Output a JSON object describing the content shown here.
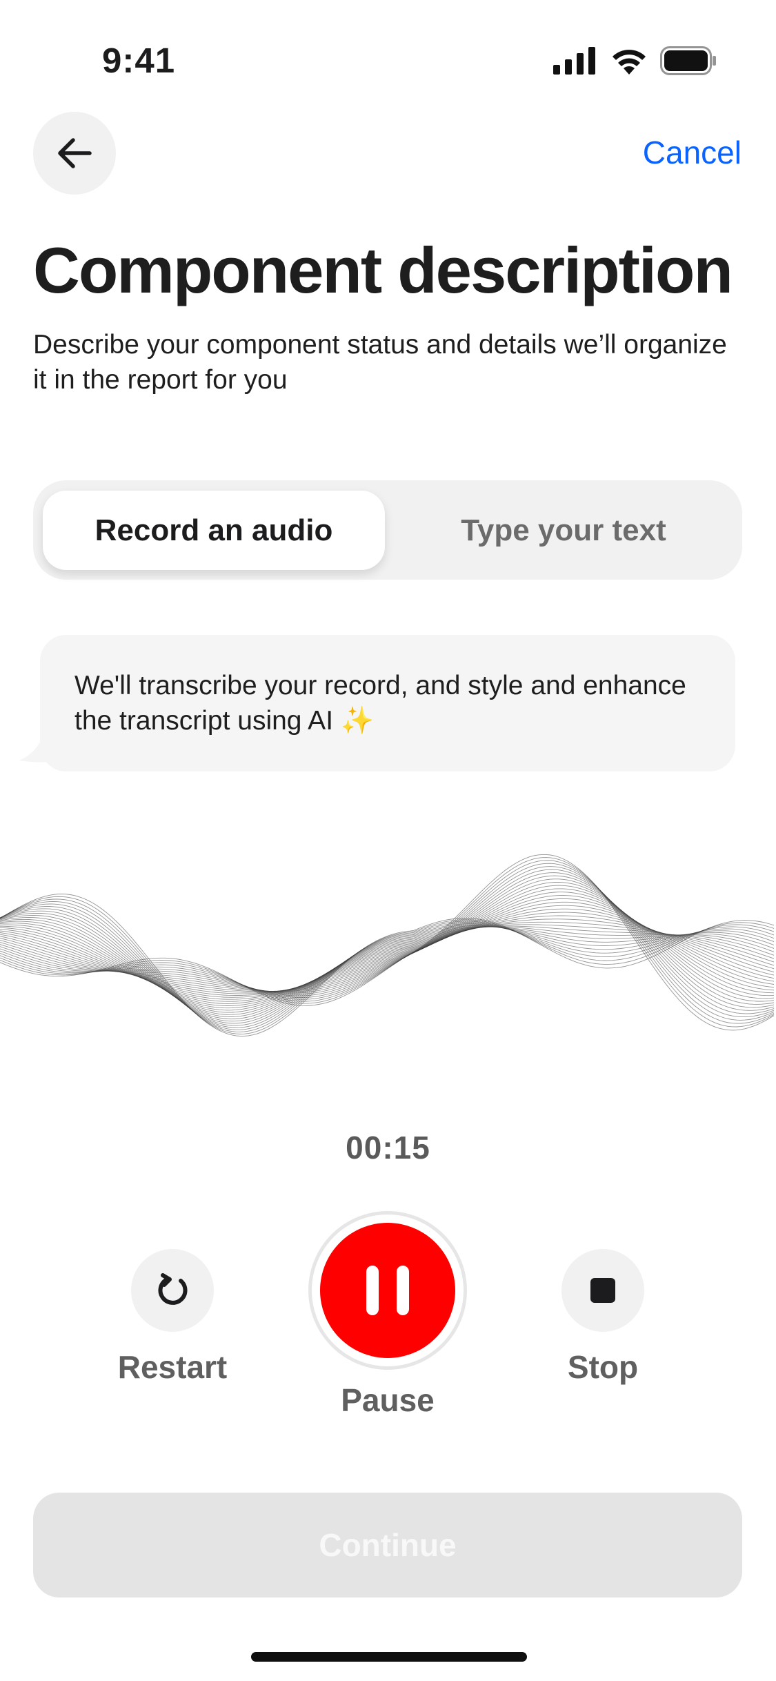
{
  "status_bar": {
    "time": "9:41"
  },
  "nav": {
    "cancel_label": "Cancel"
  },
  "header": {
    "title": "Component description",
    "subtitle": "Describe your component status and details we’ll organize it in the report for you"
  },
  "tabs": [
    {
      "label": "Record an audio",
      "selected": true
    },
    {
      "label": "Type your text",
      "selected": false
    }
  ],
  "info": {
    "text": "We'll transcribe your record, and style and enhance the transcript using AI ✨"
  },
  "recording": {
    "timer": "00:15",
    "restart_label": "Restart",
    "pause_label": "Pause",
    "stop_label": "Stop",
    "accent_color": "#ff0000"
  },
  "footer": {
    "continue_label": "Continue",
    "continue_enabled": false
  },
  "icons": [
    "back-arrow-icon",
    "restart-icon",
    "pause-icon",
    "stop-icon",
    "signal-icon",
    "wifi-icon",
    "battery-icon",
    "sparkles-icon"
  ]
}
